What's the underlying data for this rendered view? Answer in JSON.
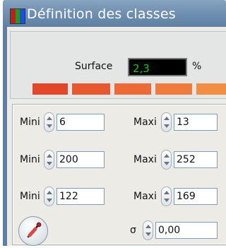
{
  "window": {
    "title": "Définition des classes"
  },
  "title_icon_colors": [
    "#d01818",
    "#18a018",
    "#2050d0"
  ],
  "surface": {
    "label": "Surface",
    "value": "2,3",
    "unit": "%"
  },
  "swatches": [
    "#e2472a",
    "#e8582f",
    "#ec6a35",
    "#ef7c3c",
    "#f28e44"
  ],
  "rows": [
    {
      "mini_label": "Mini",
      "mini_value": "6",
      "maxi_label": "Maxi",
      "maxi_value": "13"
    },
    {
      "mini_label": "Mini",
      "mini_value": "200",
      "maxi_label": "Maxi",
      "maxi_value": "252"
    },
    {
      "mini_label": "Mini",
      "mini_value": "122",
      "maxi_label": "Maxi",
      "maxi_value": "169"
    }
  ],
  "sigma": {
    "label": "σ",
    "value": "0,00"
  },
  "pipette": {
    "icon": "pipette-icon"
  }
}
